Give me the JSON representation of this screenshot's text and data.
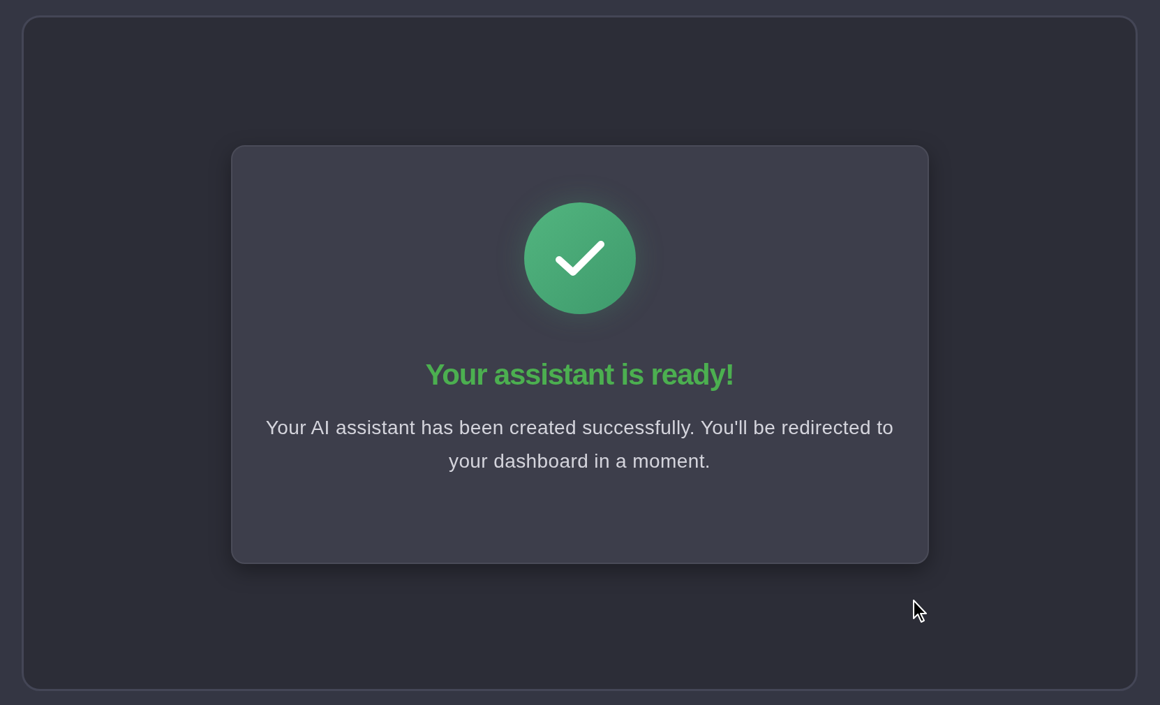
{
  "card": {
    "title": "Your assistant is ready!",
    "message": "Your AI assistant has been created successfully. You'll be redirected to your dashboard in a moment."
  }
}
